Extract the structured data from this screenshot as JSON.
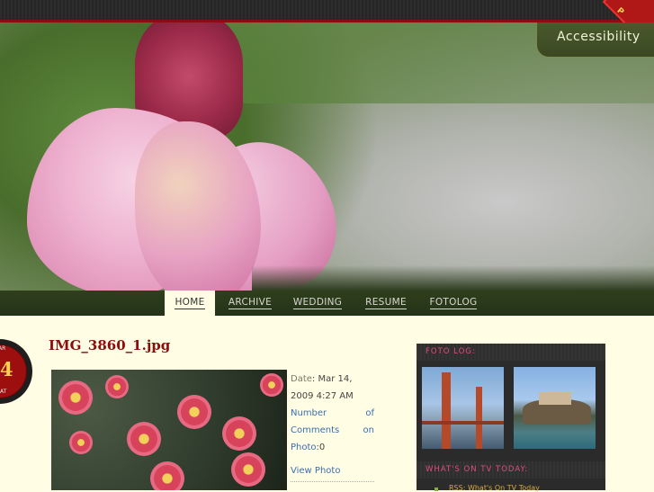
{
  "header": {
    "corner_badge": "P",
    "accessibility_label": "Accessibility"
  },
  "nav": {
    "items": [
      {
        "label": "HOME",
        "active": true
      },
      {
        "label": "ARCHIVE",
        "active": false
      },
      {
        "label": "WEDDING",
        "active": false
      },
      {
        "label": "RESUME",
        "active": false
      },
      {
        "label": "FOTOLOG",
        "active": false
      }
    ]
  },
  "post": {
    "date_badge": {
      "month": "AR",
      "day": "4",
      "weekday": "AT"
    },
    "title": "IMG_3860_1.jpg",
    "meta": {
      "date_label": "Date",
      "date_value": "Mar 14, 2009 4:27 AM",
      "comments_label": "Number of Comments on Photo",
      "comments_count": "0",
      "view_photo": "View Photo"
    }
  },
  "sidebar": {
    "fotolog_title": "FOTO LOG:",
    "tv_title": "WHAT'S ON TV TODAY:",
    "rss_item": "RSS: What's On TV Today"
  },
  "colors": {
    "accent_red": "#8b0d0d",
    "nav_green": "#2f3f1c",
    "background": "#fffde3"
  }
}
